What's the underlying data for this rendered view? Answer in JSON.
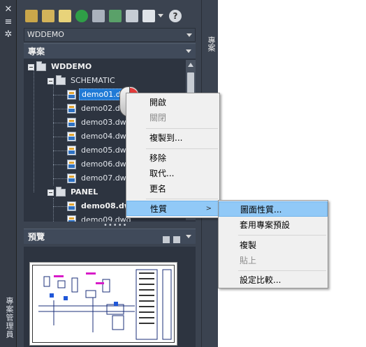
{
  "app": {
    "left_strip_label": "專案管理員",
    "right_tab_label": "專案"
  },
  "toolbar": {
    "icons": [
      "open-project-icon",
      "new-project-icon",
      "new-drawing-icon",
      "refresh-icon",
      "publish-icon",
      "project-manager-icon",
      "drawing-properties-icon",
      "plot-icon",
      "dropdown-arrow-icon",
      "help-icon"
    ]
  },
  "project_selector": {
    "value": "WDDEMO"
  },
  "projects_panel": {
    "header": "專案",
    "tree": {
      "root": "WDDEMO",
      "folders": [
        {
          "name": "SCHEMATIC",
          "items": [
            "demo01.dwg",
            "demo02.dwg",
            "demo03.dwg",
            "demo04.dwg",
            "demo05.dwg",
            "demo06.dwg",
            "demo07.dwg"
          ]
        },
        {
          "name": "PANEL",
          "items": [
            "demo08.dwg",
            "demo09.dwg"
          ]
        }
      ],
      "selected_item": "demo01.dwg"
    }
  },
  "preview_panel": {
    "header": "預覽"
  },
  "context_menu": {
    "items": [
      {
        "label": "開啟",
        "enabled": true
      },
      {
        "label": "關閉",
        "enabled": false
      },
      {
        "label": "複製到...",
        "enabled": true
      },
      {
        "label": "移除",
        "enabled": true
      },
      {
        "label": "取代...",
        "enabled": true
      },
      {
        "label": "更名",
        "enabled": true
      },
      {
        "label": "性質",
        "enabled": true,
        "has_submenu": true,
        "active": true
      }
    ]
  },
  "submenu": {
    "items": [
      {
        "label": "圖面性質...",
        "enabled": true,
        "active": true
      },
      {
        "label": "套用專案預設",
        "enabled": true
      },
      {
        "label": "複製",
        "enabled": true
      },
      {
        "label": "貼上",
        "enabled": false
      },
      {
        "label": "設定比較...",
        "enabled": true
      }
    ]
  },
  "colors": {
    "panel_bg": "#3b4350",
    "tree_bg": "#2d3440",
    "selection": "#1f7ad6",
    "menu_bg": "#f0f0f0",
    "menu_highlight": "#91c9f7"
  }
}
